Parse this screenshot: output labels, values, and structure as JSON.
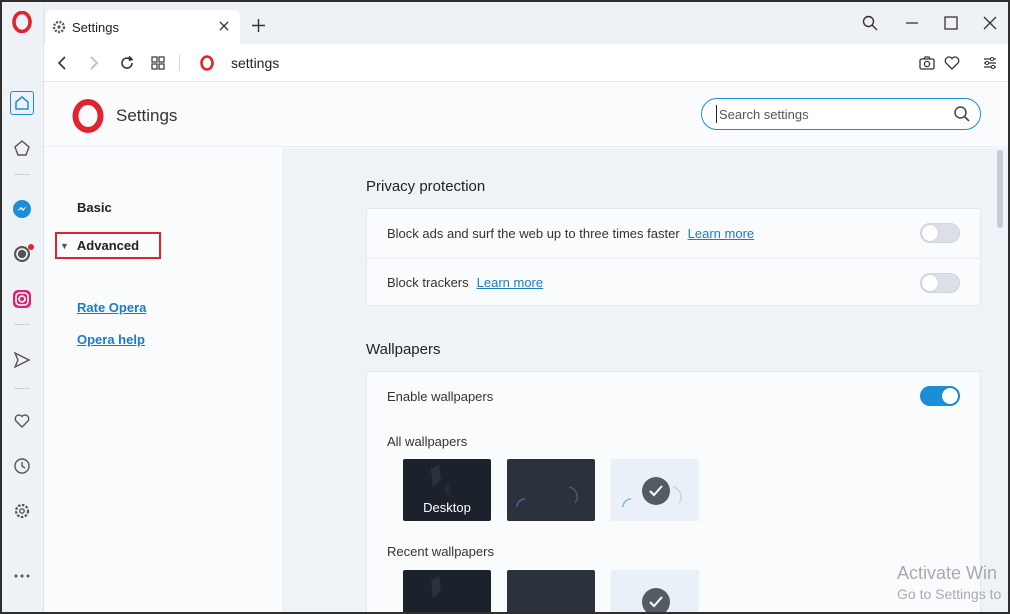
{
  "app": {
    "name": "Opera"
  },
  "tab": {
    "title": "Settings",
    "close_label": "×",
    "new_tab_label": "+"
  },
  "address_bar": {
    "url": "settings"
  },
  "settings_header": {
    "title": "Settings",
    "search_placeholder": "Search settings"
  },
  "left_nav": {
    "basic": "Basic",
    "advanced": "Advanced",
    "links": [
      "Rate Opera",
      "Opera help"
    ]
  },
  "privacy": {
    "title": "Privacy protection",
    "rows": [
      {
        "text": "Block ads and surf the web up to three times faster",
        "link": "Learn more",
        "enabled": false
      },
      {
        "text": "Block trackers",
        "link": "Learn more",
        "enabled": false
      }
    ]
  },
  "wallpapers": {
    "title": "Wallpapers",
    "enable_label": "Enable wallpapers",
    "enabled": true,
    "all_label": "All wallpapers",
    "recent_label": "Recent wallpapers",
    "thumb_desktop_label": "Desktop"
  },
  "watermark": {
    "line1": "Activate Win",
    "line2": "Go to Settings to"
  },
  "colors": {
    "accent": "#1b8fd6",
    "opera_red": "#e0242f",
    "highlight_border": "#d7262d"
  }
}
